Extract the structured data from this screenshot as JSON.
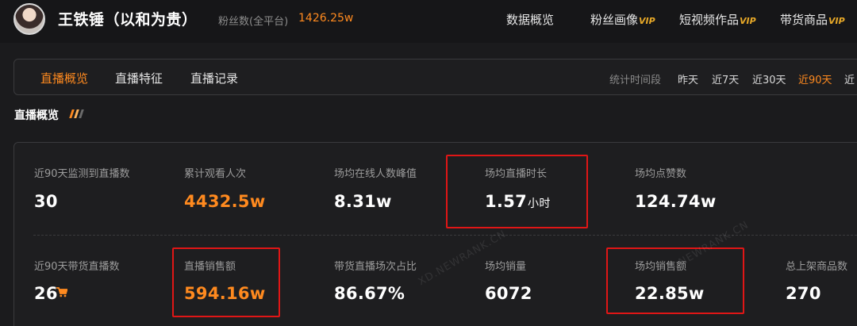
{
  "header": {
    "user_name": "王铁锤（以和为贵）",
    "fans_label": "粉丝数(全平台)",
    "fans_value": "1426.25w",
    "nav": [
      {
        "label": "数据概览",
        "vip": ""
      },
      {
        "label": "粉丝画像",
        "vip": "VIP"
      },
      {
        "label": "短视频作品",
        "vip": "VIP"
      },
      {
        "label": "带货商品",
        "vip": "VIP"
      }
    ]
  },
  "tabs": {
    "items": [
      "直播概览",
      "直播特征",
      "直播记录"
    ],
    "active_index": 0,
    "period_label": "统计时间段",
    "periods": [
      "昨天",
      "近7天",
      "近30天",
      "近90天",
      "近"
    ],
    "active_period": "近90天"
  },
  "section": {
    "title": "直播概览"
  },
  "stats": {
    "row1": [
      {
        "label": "近90天监测到直播数",
        "value": "30",
        "unit": ""
      },
      {
        "label": "累计观看人次",
        "value": "4432.5w",
        "unit": ""
      },
      {
        "label": "场均在线人数峰值",
        "value": "8.31w",
        "unit": ""
      },
      {
        "label": "场均直播时长",
        "value": "1.57",
        "unit": "小时"
      },
      {
        "label": "场均点赞数",
        "value": "124.74w",
        "unit": ""
      }
    ],
    "row2": [
      {
        "label": "近90天带货直播数",
        "value": "26",
        "unit": ""
      },
      {
        "label": "直播销售额",
        "value": "594.16w",
        "unit": ""
      },
      {
        "label": "带货直播场次占比",
        "value": "86.67%",
        "unit": ""
      },
      {
        "label": "场均销量",
        "value": "6072",
        "unit": ""
      },
      {
        "label": "场均销售额",
        "value": "22.85w",
        "unit": ""
      },
      {
        "label": "总上架商品数",
        "value": "270",
        "unit": ""
      }
    ]
  },
  "watermark": {
    "text1": "XD.NEWRANK.CN",
    "text2": "NEWRANK.CN"
  },
  "colors": {
    "accent": "#ff8a1f",
    "highlight": "#e01616",
    "vip": "#e8a928",
    "background": "#1b1b1d"
  },
  "icons": {
    "avatar": "user-avatar",
    "cart": "shopping-cart-icon",
    "title_deco": "stripes-icon"
  }
}
